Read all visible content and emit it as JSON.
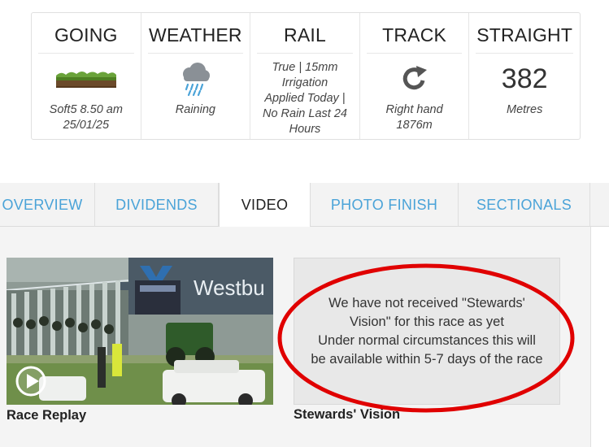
{
  "conditions": {
    "going": {
      "heading": "GOING",
      "icon": "turf-icon",
      "detail_line1": "Soft5 8.50 am",
      "detail_line2": "25/01/25"
    },
    "weather": {
      "heading": "WEATHER",
      "icon": "rain-cloud-icon",
      "detail": "Raining"
    },
    "rail": {
      "heading": "RAIL",
      "line1": "True | 15mm",
      "line2": "Irrigation",
      "line3": "Applied Today |",
      "line4": "No Rain Last 24",
      "line5": "Hours"
    },
    "track": {
      "heading": "TRACK",
      "icon": "clockwise-arrow-icon",
      "detail_line1": "Right hand",
      "detail_line2": "1876m"
    },
    "straight": {
      "heading": "STRAIGHT",
      "value": "382",
      "unit": "Metres"
    }
  },
  "tabs": [
    {
      "label": "OVERVIEW",
      "active": false
    },
    {
      "label": "DIVIDENDS",
      "active": false
    },
    {
      "label": "VIDEO",
      "active": true
    },
    {
      "label": "PHOTO FINISH",
      "active": false
    },
    {
      "label": "SECTIONALS",
      "active": false
    }
  ],
  "videos": {
    "replay": {
      "caption": "Race Replay",
      "thumb_signage": "Westbu"
    },
    "stewards": {
      "caption": "Stewards' Vision",
      "message_line1": "We have not received \"Stewards'",
      "message_line2": "Vision\" for this race as yet",
      "message_line3": "Under normal circumstances this will",
      "message_line4": "be available within 5-7 days of the race"
    }
  },
  "colors": {
    "tab_link": "#4aa3d8",
    "annotation_red": "#e00000",
    "turf_green": "#5a8a2a",
    "turf_soil": "#6b4a2a"
  }
}
